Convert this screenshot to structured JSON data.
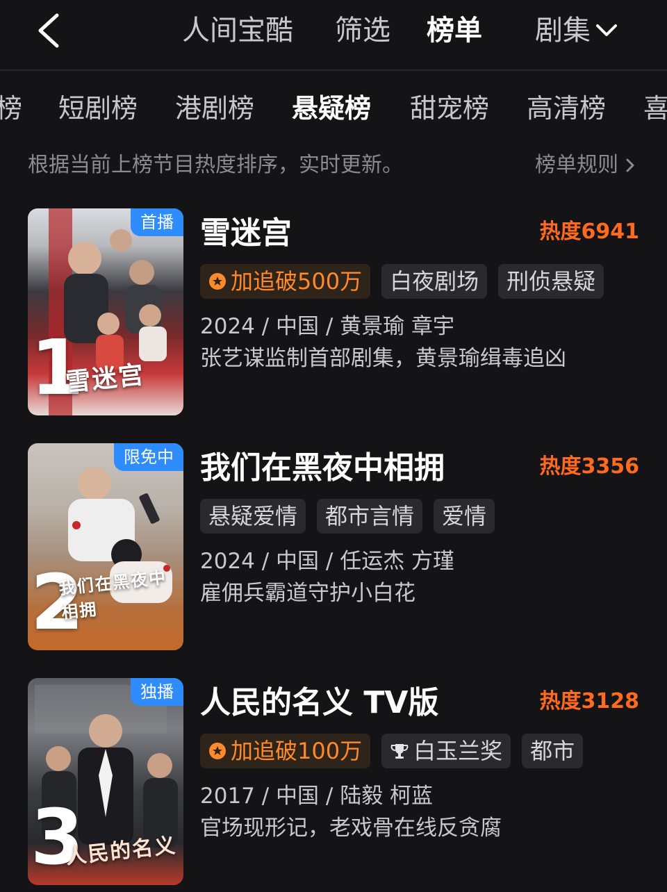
{
  "nav": {
    "tabs": [
      "人间宝酷",
      "筛选",
      "榜单"
    ],
    "dropdown_label": "剧集"
  },
  "categories": [
    "榜",
    "短剧榜",
    "港剧榜",
    "悬疑榜",
    "甜宠榜",
    "高清榜",
    "喜"
  ],
  "subtitle": "根据当前上榜节目热度排序，实时更新。",
  "rules_label": "榜单规则",
  "items": [
    {
      "rank": "1",
      "badge": "首播",
      "poster_title": "雪迷宫",
      "title": "雪迷宫",
      "heat": "热度6941",
      "tags": [
        "加追破500万",
        "白夜剧场",
        "刑侦悬疑"
      ],
      "meta": "2024 / 中国 / 黄景瑜 章宇",
      "desc": "张艺谋监制首部剧集，黄景瑜缉毒追凶"
    },
    {
      "rank": "2",
      "badge": "限免中",
      "poster_title": "我们在黑夜中相拥",
      "title": "我们在黑夜中相拥",
      "heat": "热度3356",
      "tags": [
        "悬疑爱情",
        "都市言情",
        "爱情"
      ],
      "meta": "2024 / 中国 / 任运杰 方瑾",
      "desc": "雇佣兵霸道守护小白花"
    },
    {
      "rank": "3",
      "badge": "独播",
      "poster_title": "人民的名义",
      "title": "人民的名义 TV版",
      "heat": "热度3128",
      "tags": [
        "加追破100万",
        "白玉兰奖",
        "都市"
      ],
      "meta": "2017 / 中国 / 陆毅 柯蓝",
      "desc": "官场现形记，老戏骨在线反贪腐"
    }
  ],
  "colors": {
    "background": "#141416",
    "accent_heat": "#ff6a1f",
    "badge_blue": "#2f8cff"
  }
}
